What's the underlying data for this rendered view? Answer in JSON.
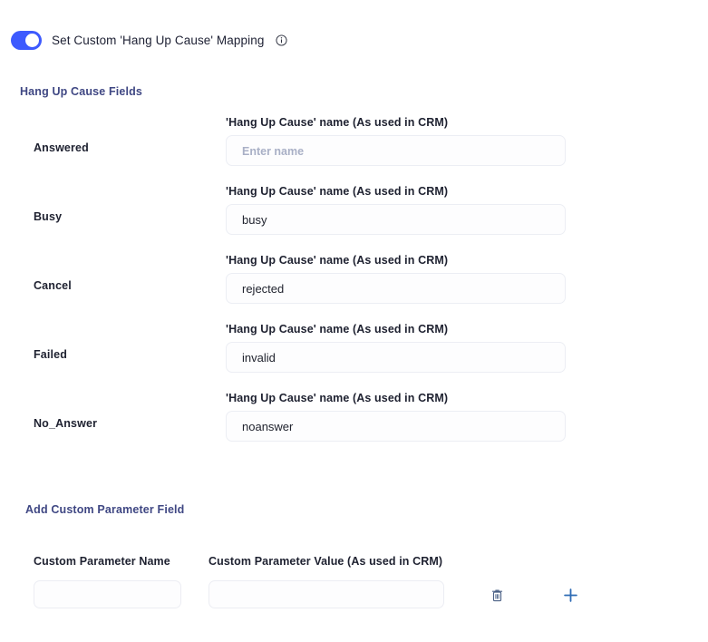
{
  "toggle": {
    "label": "Set Custom 'Hang Up Cause' Mapping",
    "state": "on",
    "accent_color": "#3d5afe",
    "info_icon": "info-circle-icon"
  },
  "hangup_section": {
    "title": "Hang Up Cause Fields",
    "title_color": "#3f4783",
    "column_caption": "'Hang Up Cause' name (As used in CRM)",
    "placeholder": "Enter name",
    "rows": [
      {
        "label": "Answered",
        "value": ""
      },
      {
        "label": "Busy",
        "value": "busy"
      },
      {
        "label": "Cancel",
        "value": "rejected"
      },
      {
        "label": "Failed",
        "value": "invalid"
      },
      {
        "label": "No_Answer",
        "value": "noanswer"
      }
    ]
  },
  "custom_section": {
    "title": "Add Custom Parameter Field",
    "title_color": "#3f4783",
    "name_header": "Custom Parameter Name",
    "value_header": "Custom Parameter Value (As used in CRM)",
    "name_value": "",
    "value_value": "",
    "delete_icon": "trash-icon",
    "delete_icon_color": "#4a6085",
    "add_icon": "plus-icon",
    "add_icon_color": "#2f6cb5"
  }
}
